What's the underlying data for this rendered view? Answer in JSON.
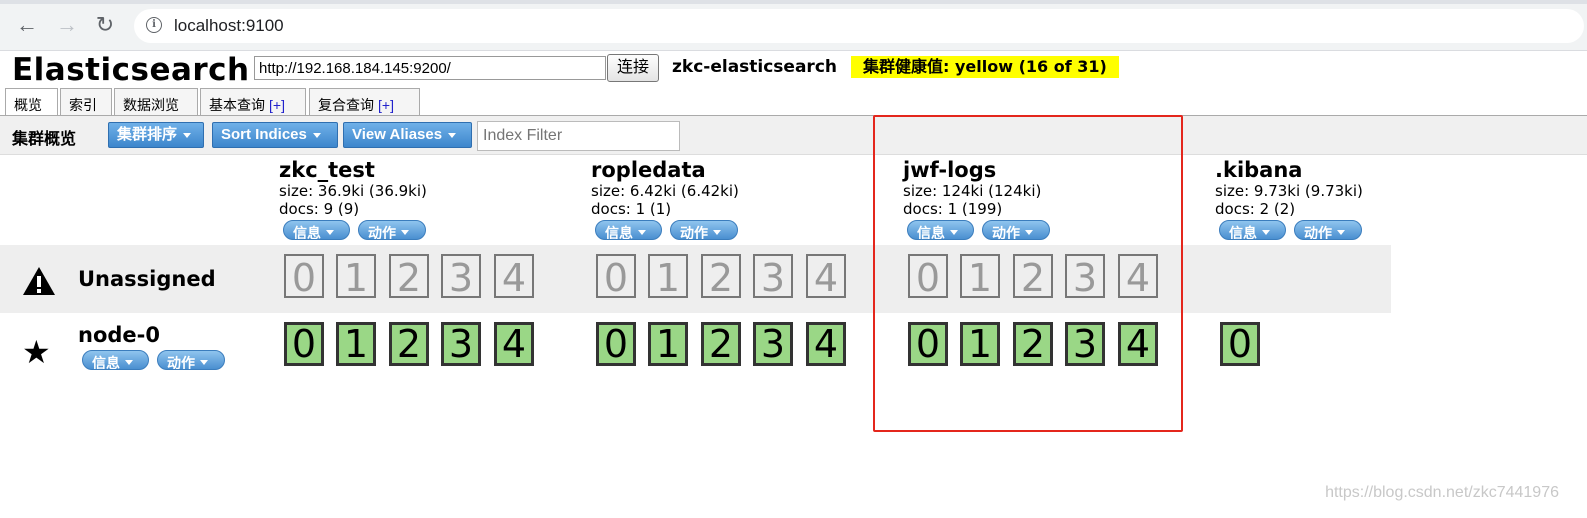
{
  "browser": {
    "url": "localhost:9100",
    "back_icon": "←",
    "forward_icon": "→",
    "reload_icon": "↻",
    "info_icon": "i"
  },
  "header": {
    "title": "Elasticsearch",
    "url_value": "http://192.168.184.145:9200/",
    "connect_label": "连接",
    "cluster_name": "zkc-elasticsearch",
    "health_text": "集群健康值: yellow (16 of 31)",
    "health_color": "#ffff00"
  },
  "tabs": [
    {
      "label": "概览",
      "plus": ""
    },
    {
      "label": "索引",
      "plus": ""
    },
    {
      "label": "数据浏览",
      "plus": ""
    },
    {
      "label": "基本查询",
      "plus": "[+]"
    },
    {
      "label": "复合查询",
      "plus": "[+]"
    }
  ],
  "toolbar": {
    "title": "集群概览",
    "sort_cluster_label": "集群排序",
    "sort_indices_label": "Sort Indices",
    "view_aliases_label": "View Aliases",
    "filter_placeholder": "Index Filter"
  },
  "indices": [
    {
      "name": "zkc_test",
      "size": "size: 36.9ki (36.9ki)",
      "docs": "docs: 9 (9)",
      "info_label": "信息",
      "action_label": "动作"
    },
    {
      "name": "ropledata",
      "size": "size: 6.42ki (6.42ki)",
      "docs": "docs: 1 (1)",
      "info_label": "信息",
      "action_label": "动作"
    },
    {
      "name": "jwf-logs",
      "size": "size: 124ki (124ki)",
      "docs": "docs: 1 (199)",
      "info_label": "信息",
      "action_label": "动作"
    },
    {
      "name": ".kibana",
      "size": "size: 9.73ki (9.73ki)",
      "docs": "docs: 2 (2)",
      "info_label": "信息",
      "action_label": "动作"
    }
  ],
  "rows": {
    "unassigned": {
      "label": "Unassigned",
      "icon": "warning-icon"
    },
    "node": {
      "label": "node-0",
      "icon": "star-icon",
      "info_label": "信息",
      "action_label": "动作"
    }
  },
  "shard_numbers": [
    "0",
    "1",
    "2",
    "3",
    "4"
  ],
  "colors": {
    "assigned_shard": "#9ad786",
    "highlight": "#e4261c",
    "button_blue": "#4a8fd0"
  },
  "watermark": "https://blog.csdn.net/zkc7441976"
}
